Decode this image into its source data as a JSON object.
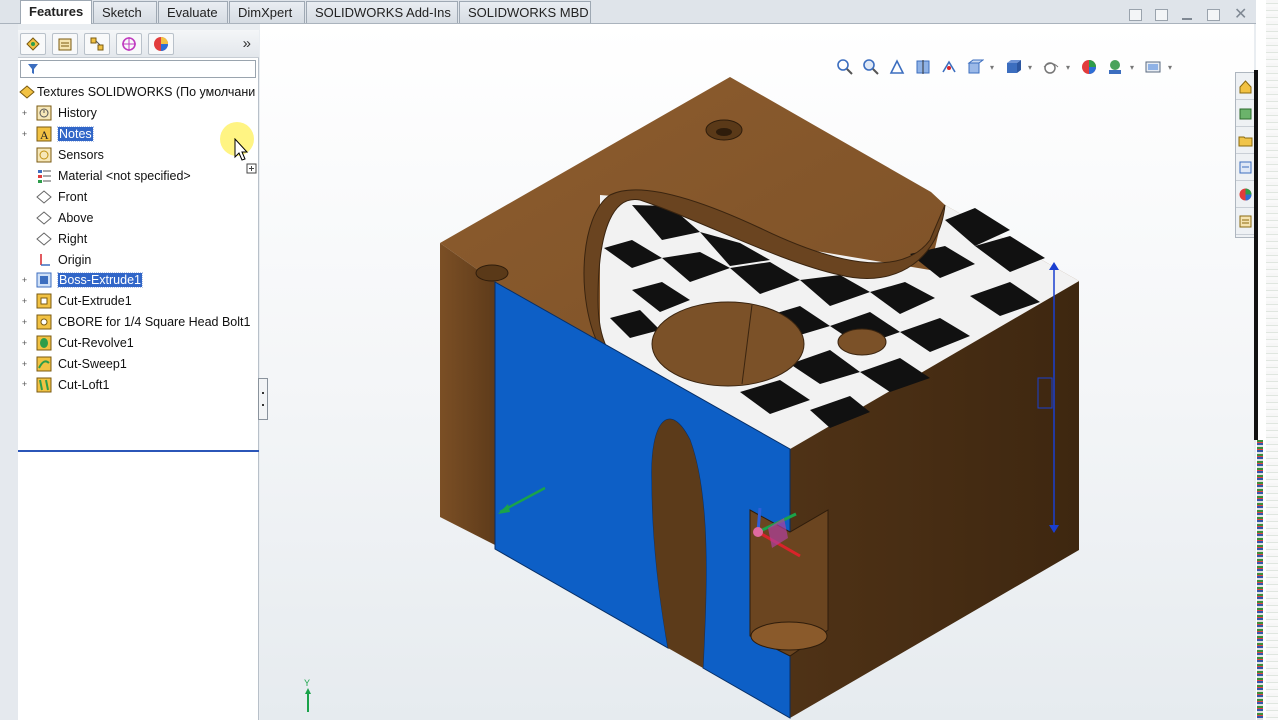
{
  "tabs": [
    {
      "label": "Features",
      "active": true
    },
    {
      "label": "Sketch",
      "active": false
    },
    {
      "label": "Evaluate",
      "active": false
    },
    {
      "label": "DimXpert",
      "active": false
    },
    {
      "label": "SOLIDWORKS Add-Ins",
      "active": false
    },
    {
      "label": "SOLIDWORKS MBD",
      "active": false
    }
  ],
  "feature_tree": {
    "root": "Textures SOLIDWORKS  (По умолчани",
    "items": [
      {
        "label": "History",
        "icon": "history-icon",
        "expandable": true,
        "selected": false
      },
      {
        "label": "Notes",
        "icon": "notes-icon",
        "expandable": true,
        "selected": true
      },
      {
        "label": "Sensors",
        "icon": "sensors-icon",
        "expandable": false,
        "selected": false
      },
      {
        "label": "Material <not specified>",
        "icon": "material-icon",
        "expandable": false,
        "selected": false
      },
      {
        "label": "Front",
        "icon": "plane-icon",
        "expandable": false,
        "selected": false
      },
      {
        "label": "Above",
        "icon": "plane-icon",
        "expandable": false,
        "selected": false
      },
      {
        "label": "Right",
        "icon": "plane-icon",
        "expandable": false,
        "selected": false
      },
      {
        "label": "Origin",
        "icon": "origin-icon",
        "expandable": false,
        "selected": false
      },
      {
        "label": "Boss-Extrude1",
        "icon": "boss-extrude-icon",
        "expandable": true,
        "selected": true
      },
      {
        "label": "Cut-Extrude1",
        "icon": "cut-extrude-icon",
        "expandable": true,
        "selected": false
      },
      {
        "label": "CBORE for 1/4 Square Head Bolt1",
        "icon": "hole-wizard-icon",
        "expandable": true,
        "selected": false
      },
      {
        "label": "Cut-Revolve1",
        "icon": "cut-revolve-icon",
        "expandable": true,
        "selected": false
      },
      {
        "label": "Cut-Sweep1",
        "icon": "cut-sweep-icon",
        "expandable": true,
        "selected": false
      },
      {
        "label": "Cut-Loft1",
        "icon": "cut-loft-icon",
        "expandable": true,
        "selected": false
      }
    ]
  },
  "fm_toolbar": {
    "buttons": [
      "featuremanager-icon",
      "propertymanager-icon",
      "configurationmanager-icon",
      "dimxpert-icon",
      "display-manager-icon"
    ],
    "more_label": "»"
  },
  "headsup_toolbar": [
    "zoom-to-fit-icon",
    "zoom-to-area-icon",
    "previous-view-icon",
    "section-view-icon",
    "dynamic-annotation-icon",
    "view-orientation-icon",
    "display-style-icon",
    "hide-show-icon",
    "edit-appearance-icon",
    "apply-scene-icon",
    "view-settings-icon"
  ],
  "task_pane": [
    "resources-icon",
    "design-library-icon",
    "file-explorer-icon",
    "view-palette-icon",
    "appearances-icon",
    "custom-properties-icon"
  ],
  "colors": {
    "bronze": "#8a5a2b",
    "bronze_dark": "#4a2f14",
    "blue_face": "#0d5fc6",
    "selection": "#3166c8"
  },
  "triad_label": "Y"
}
